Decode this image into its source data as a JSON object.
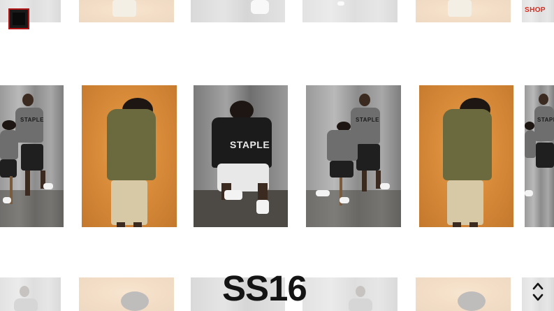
{
  "header": {
    "menu_icon": "menu-square-icon",
    "shop_label": "SHOP"
  },
  "colors": {
    "accent": "#d72b1e",
    "menu_border": "#b01414",
    "title": "#141414",
    "background": "#ffffff"
  },
  "lookbook": {
    "season_title": "SS16",
    "photo_text": [
      "STAPLE",
      "STAPLE",
      "STAPLE",
      "STAPLE"
    ]
  },
  "navigation": {
    "up_icon": "chevron-up-icon",
    "down_icon": "chevron-down-icon"
  }
}
